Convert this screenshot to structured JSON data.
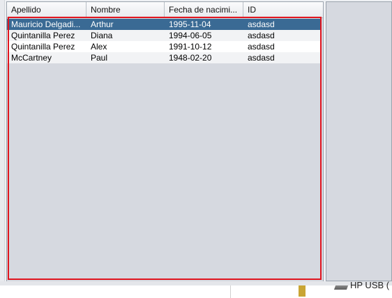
{
  "table": {
    "columns": [
      "Apellido",
      "Nombre",
      "Fecha de nacimi...",
      "ID"
    ],
    "rows": [
      {
        "apellido": "Mauricio Delgadi...",
        "nombre": "Arthur",
        "fecha": "1995-11-04",
        "id": "asdasd"
      },
      {
        "apellido": "Quintanilla Perez",
        "nombre": "Diana",
        "fecha": "1994-06-05",
        "id": "asdasd"
      },
      {
        "apellido": "Quintanilla Perez",
        "nombre": "Alex",
        "fecha": "1991-10-12",
        "id": "asdasd"
      },
      {
        "apellido": "McCartney",
        "nombre": "Paul",
        "fecha": "1948-02-20",
        "id": "asdasd"
      }
    ]
  },
  "background": {
    "drive_label": "HP USB ("
  }
}
